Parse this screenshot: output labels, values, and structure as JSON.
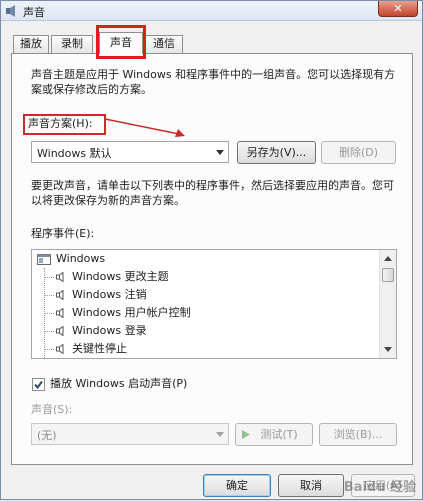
{
  "window": {
    "title": "声音",
    "close_label": "✕"
  },
  "tabs": [
    {
      "label": "播放",
      "active": false
    },
    {
      "label": "录制",
      "active": false
    },
    {
      "label": "声音",
      "active": true
    },
    {
      "label": "通信",
      "active": false
    }
  ],
  "description": {
    "line1": "声音主题是应用于 Windows 和程序事件中的一组声音。您可以选择现有方",
    "line2": "案或保存修改后的方案。"
  },
  "scheme": {
    "label": "声音方案(H):",
    "selected": "Windows 默认",
    "save_as_button": "另存为(V)...",
    "delete_button": "删除(D)"
  },
  "instructions": {
    "line1": "要更改声音，请单击以下列表中的程序事件，然后选择要应用的声音。您可",
    "line2": "以将更改保存为新的声音方案。"
  },
  "events": {
    "label": "程序事件(E):",
    "group": "Windows",
    "items": [
      "Windows 更改主题",
      "Windows 注销",
      "Windows 用户帐户控制",
      "Windows 登录",
      "关键性停止"
    ]
  },
  "startup": {
    "checked": true,
    "label": "播放 Windows 启动声音(P)"
  },
  "sound": {
    "label": "声音(S):",
    "selected": "(无)",
    "test_button": "测试(T)",
    "browse_button": "浏览(B)..."
  },
  "footer": {
    "ok_button": "确定",
    "cancel_button": "取消",
    "apply_button": "应用(A)"
  },
  "watermark": "Baidu 经验",
  "colors": {
    "highlight_red": "#d61f1f",
    "arrow_red": "#c92a2a"
  }
}
